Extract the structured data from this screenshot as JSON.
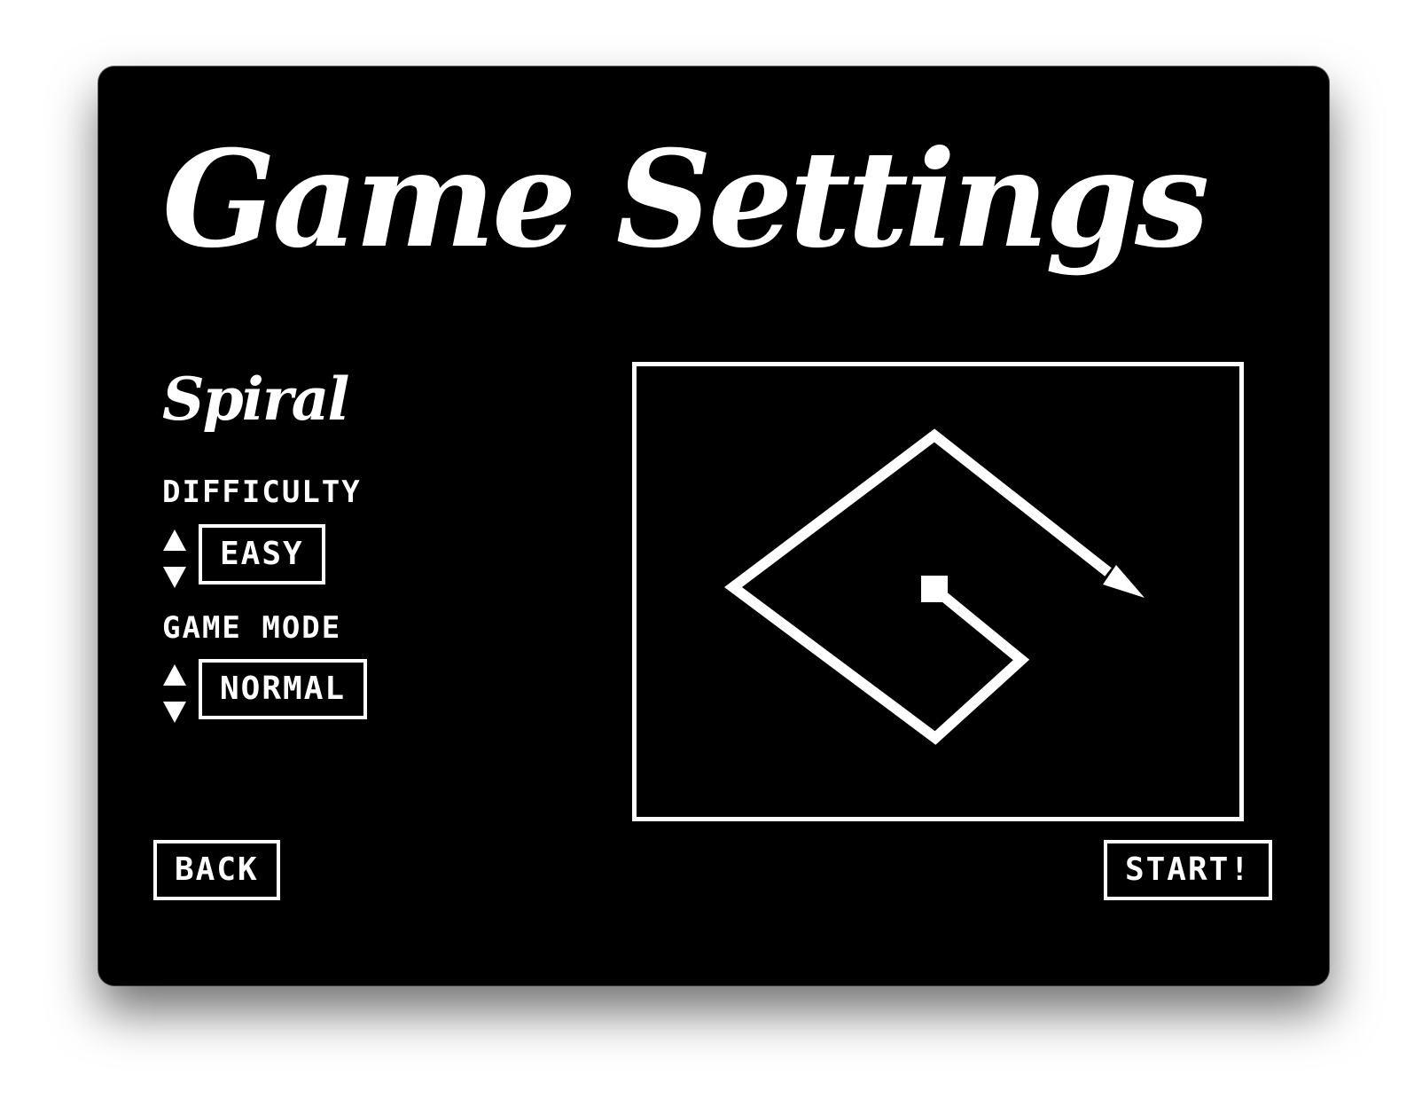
{
  "title": "Game Settings",
  "mode_name": "Spiral",
  "settings": {
    "difficulty": {
      "label": "DIFFICULTY",
      "value": "EASY"
    },
    "game_mode": {
      "label": "GAME MODE",
      "value": "NORMAL"
    }
  },
  "buttons": {
    "back": "BACK",
    "start": "START!"
  },
  "icons": {
    "stepper_up": "triangle-up-icon",
    "stepper_down": "triangle-down-icon",
    "preview": "spiral-path-icon"
  },
  "colors": {
    "background": "#000000",
    "foreground": "#ffffff"
  }
}
